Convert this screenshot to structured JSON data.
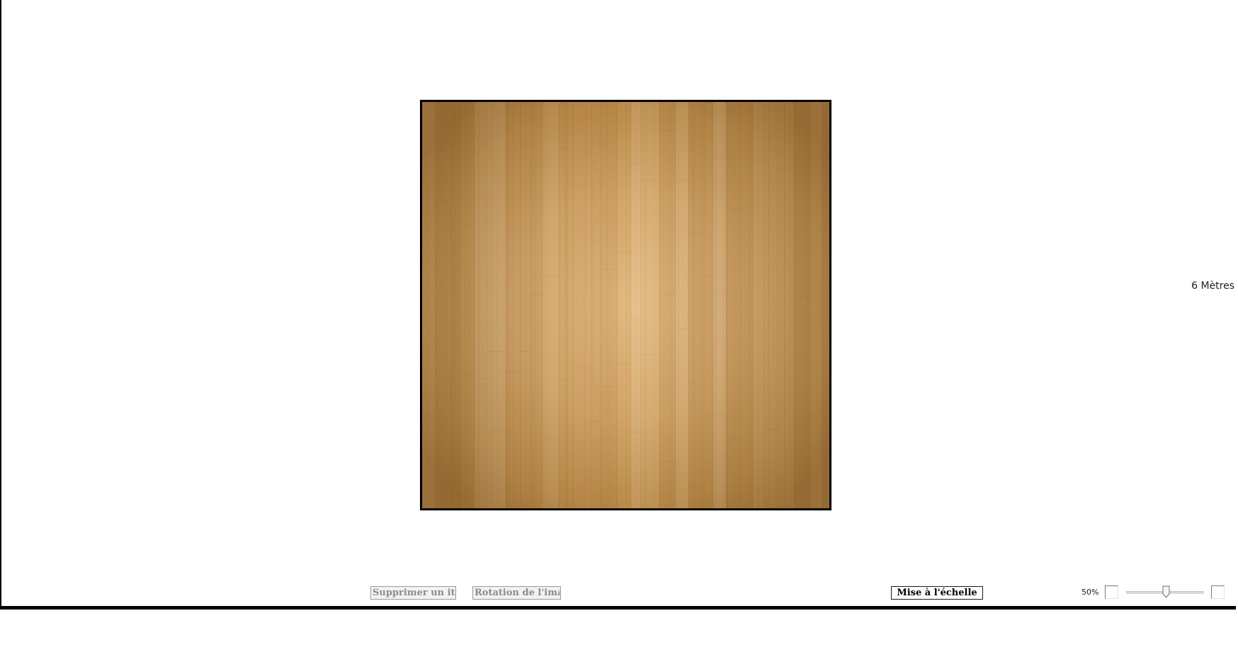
{
  "canvas": {
    "floor_texture": "light-oak-wood-planks",
    "border_color": "#000000"
  },
  "scale_label": "6 Mètres",
  "toolbar": {
    "delete_label": "Supprimer un item",
    "rotate_label": "Rotation de l'image",
    "scale_label": "Mise à l'échelle"
  },
  "zoom": {
    "value_text": "50%",
    "level": 0.5
  }
}
